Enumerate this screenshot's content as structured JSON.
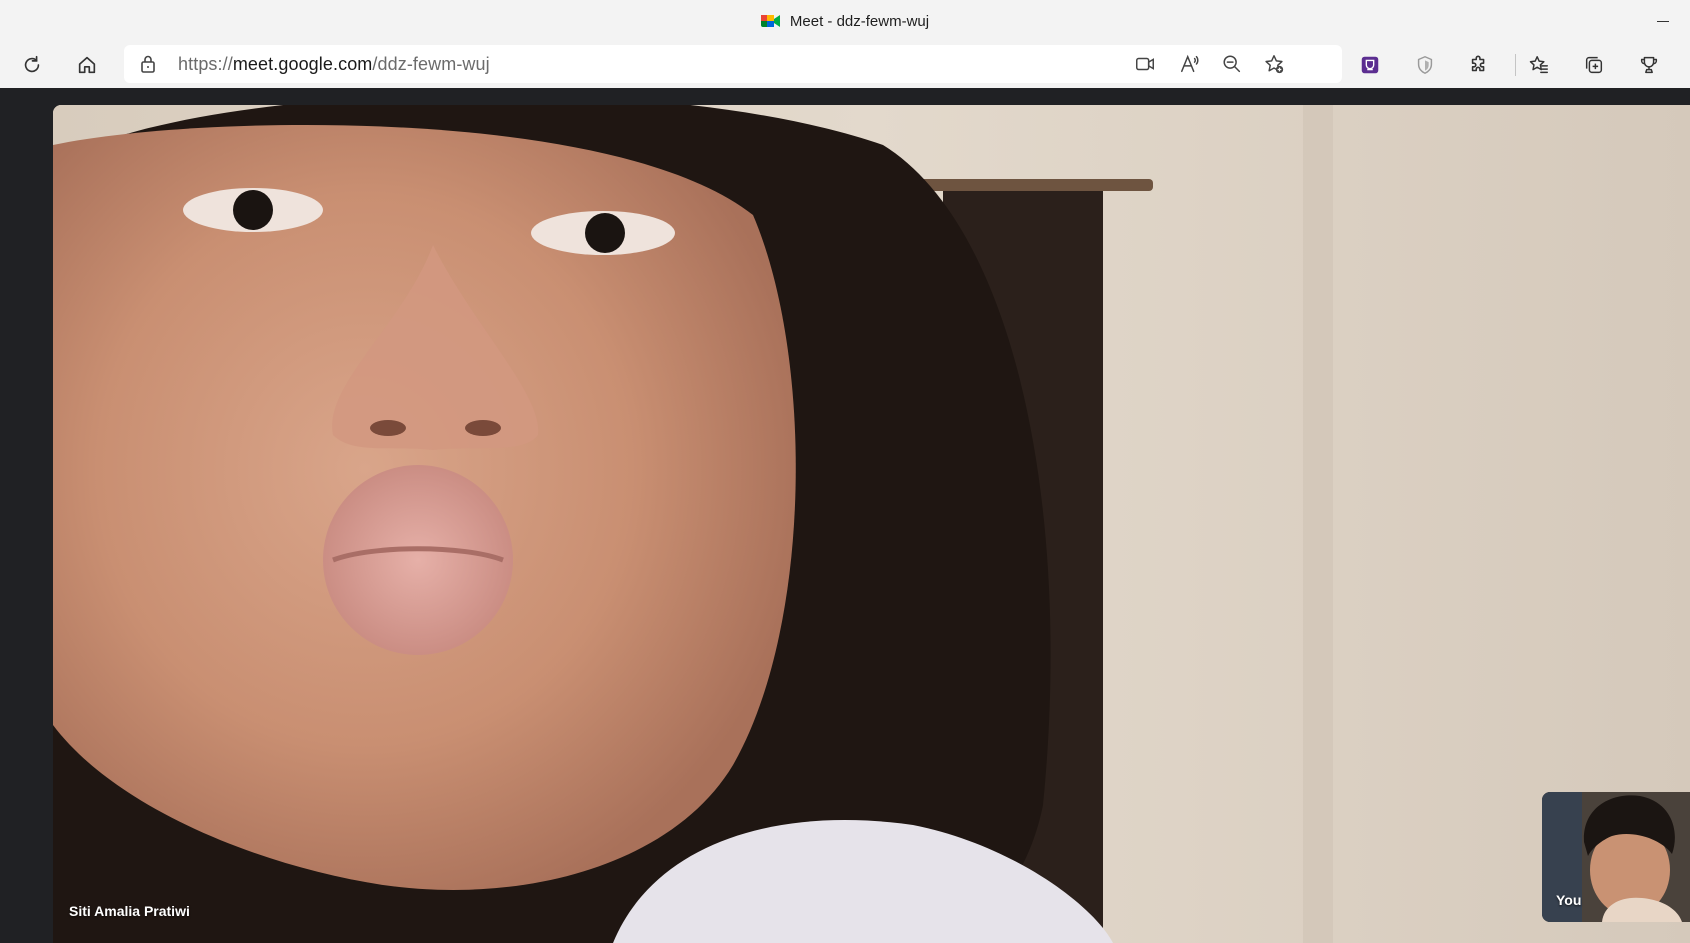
{
  "window": {
    "title": "Meet - ddz-fewm-wuj"
  },
  "toolbar": {
    "url_protocol": "https://",
    "url_domain": "meet.google.com",
    "url_path": "/ddz-fewm-wuj",
    "left_buttons": [
      "refresh-icon",
      "home-icon"
    ],
    "address_icons": [
      "lock-icon",
      "camera-icon",
      "read-aloud-icon",
      "zoom-out-icon",
      "add-favorite-icon"
    ],
    "right_buttons": [
      "extension-icon-purple",
      "shield-extension-icon",
      "extensions-puzzle-icon",
      "favorites-icon",
      "collections-icon",
      "rewards-icon"
    ]
  },
  "meeting": {
    "main_participant_name": "Siti Amalia Pratiwi",
    "self_view_label": "You"
  },
  "colors": {
    "chrome_bg": "#f3f3f3",
    "meet_bg": "#202124",
    "accent_purple": "#5b2d90"
  }
}
